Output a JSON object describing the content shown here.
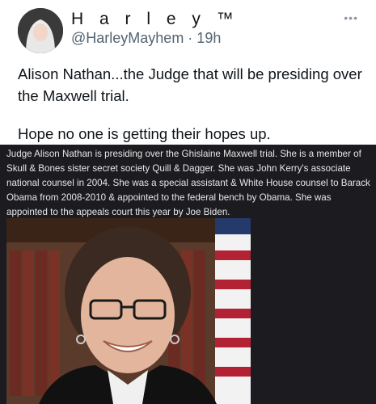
{
  "tweet": {
    "display_name": "H a r l e y ™",
    "handle_line": "@HarleyMayhem · 19h",
    "more_icon": "more-horizontal-icon",
    "text_line1": "Alison Nathan...the Judge that will be presiding over the Maxwell trial.",
    "text_line2": "Hope no one is getting their hopes up."
  },
  "media": {
    "caption": "Judge Alison Nathan is presiding over the Ghislaine Maxwell trial. She is a member of Skull & Bones sister secret society Quill & Dagger. She was John Kerry's associate national counsel in 2004. She was a special assistant & White House counsel to Barack Obama from 2008-2010 & appointed to the federal bench by Obama. She was appointed to the appeals court this year by Joe Biden."
  },
  "colors": {
    "text": "#0f1419",
    "secondary": "#536471",
    "media_bg": "#1c1c20"
  }
}
